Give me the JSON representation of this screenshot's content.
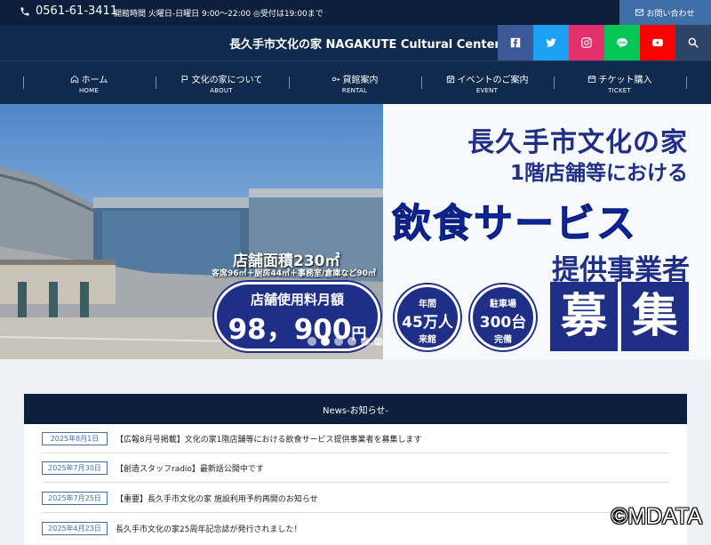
{
  "topbar": {
    "phone": "0561-61-3411",
    "hours": "開館時間 火曜日-日曜日 9:00〜22:00 ◎受付は19:00まで",
    "contact_label": "お問い合わせ"
  },
  "header": {
    "site_title": "長久手市文化の家 NAGAKUTE Cultural Center",
    "social_icons": [
      "facebook-icon",
      "twitter-icon",
      "instagram-icon",
      "line-icon",
      "youtube-icon",
      "search-icon"
    ],
    "social_colors": [
      "#3b5998",
      "#1da1f2",
      "#e1306c",
      "#06c755",
      "#ff0000",
      "#0f2a4d"
    ]
  },
  "nav": {
    "items": [
      {
        "label": "ホーム",
        "sub": "HOME",
        "icon": "home-icon"
      },
      {
        "label": "文化の家について",
        "sub": "ABOUT",
        "icon": "flag-icon"
      },
      {
        "label": "貸館案内",
        "sub": "RENTAL",
        "icon": "key-icon"
      },
      {
        "label": "イベントのご案内",
        "sub": "EVENT",
        "icon": "calendar-icon"
      },
      {
        "label": "チケット購入",
        "sub": "TICKET",
        "icon": "ticket-icon"
      }
    ]
  },
  "hero": {
    "line1": "長久手市文化の家",
    "line2": "1階店舗等における",
    "line3": "飲食サービス",
    "line4": "提供事業者",
    "boshu": [
      "募",
      "集"
    ],
    "visitors": {
      "a": "年間",
      "b": "45万人",
      "c": "来館"
    },
    "parking": {
      "a": "駐車場",
      "b": "300台",
      "c": "完備"
    },
    "area_label": "店舗面積230㎡",
    "area_sub": "客席96㎡＋厨房44㎡＋事務室/倉庫など90㎡",
    "fee_label": "店舗使用料月額",
    "fee_value": "98，900",
    "fee_unit": "円",
    "slide_count": 6,
    "active_slide": 1
  },
  "news": {
    "heading": "News-お知らせ-",
    "items": [
      {
        "date": "2025年8月1日",
        "text": "【広報8月号掲載】文化の家1階店舗等における飲食サービス提供事業者を募集します"
      },
      {
        "date": "2025年7月30日",
        "text": "【創造スタッフradio】最新話公開中です"
      },
      {
        "date": "2025年7月25日",
        "text": "【重要】長久手市文化の家 施設利用予約再開のお知らせ"
      },
      {
        "date": "2025年4月23日",
        "text": "長久手市文化の家25周年記念誌が発行されました！"
      }
    ]
  },
  "watermark": "©MDATA"
}
